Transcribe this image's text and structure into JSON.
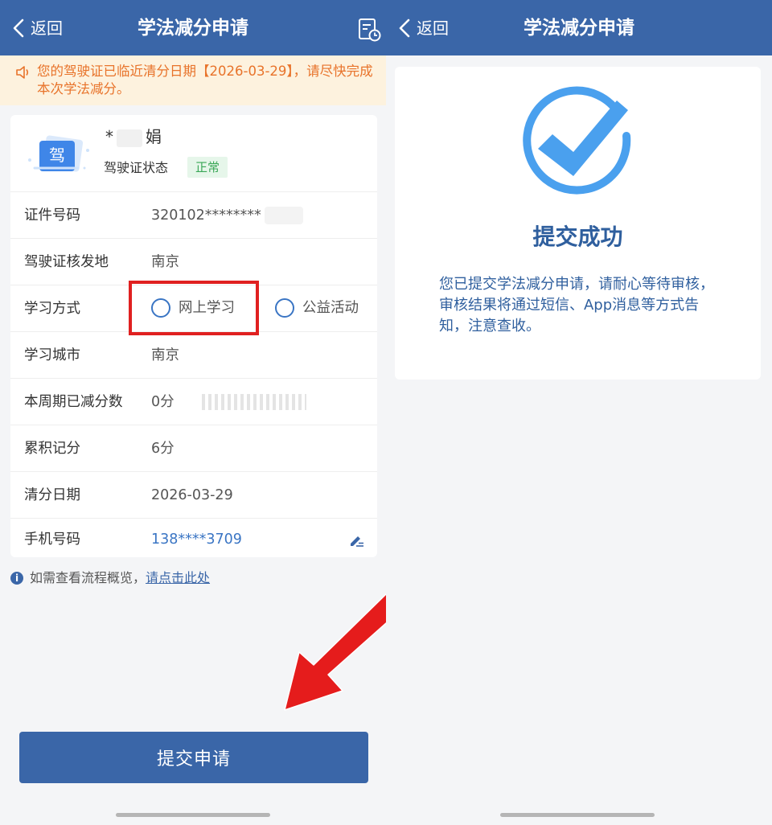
{
  "left": {
    "nav": {
      "back_label": "返回",
      "title": "学法减分申请"
    },
    "notice": "您的驾驶证已临近清分日期【2026-03-29】，请尽快完成本次学法减分。",
    "profile": {
      "license_char": "驾",
      "name_first": "*",
      "name_last": "娟",
      "status_label": "驾驶证状态",
      "status_value": "正常"
    },
    "rows": {
      "id": {
        "label": "证件号码",
        "value": "320102********"
      },
      "issue_place": {
        "label": "驾驶证核发地",
        "value": "南京"
      },
      "study_mode": {
        "label": "学习方式",
        "option1": "网上学习",
        "option2": "公益活动"
      },
      "study_city": {
        "label": "学习城市",
        "value": "南京"
      },
      "reduced": {
        "label": "本周期已减分数",
        "value": "0分"
      },
      "points": {
        "label": "累积记分",
        "value": "6分"
      },
      "clear_date": {
        "label": "清分日期",
        "value": "2026-03-29"
      },
      "phone": {
        "label": "手机号码",
        "value": "138****3709"
      }
    },
    "info": {
      "text": "如需查看流程概览，",
      "link": "请点击此处",
      "icon_char": "i"
    },
    "submit_label": "提交申请"
  },
  "right": {
    "nav": {
      "back_label": "返回",
      "title": "学法减分申请"
    },
    "success_title": "提交成功",
    "success_message": "您已提交学法减分申请，请耐心等待审核，审核结果将通过短信、App消息等方式告知，注意查收。"
  },
  "colors": {
    "nav": "#3a66a8",
    "notice_bg": "#fdf2de",
    "notice_text": "#e8732a",
    "badge_text": "#3aa757",
    "highlight": "#e02020",
    "check": "#4aa0ee"
  },
  "icons": [
    "chevron-left-icon",
    "record-clock-icon",
    "speaker-icon",
    "license-icon",
    "edit-icon",
    "info-icon",
    "check-circle-icon",
    "red-arrow"
  ]
}
